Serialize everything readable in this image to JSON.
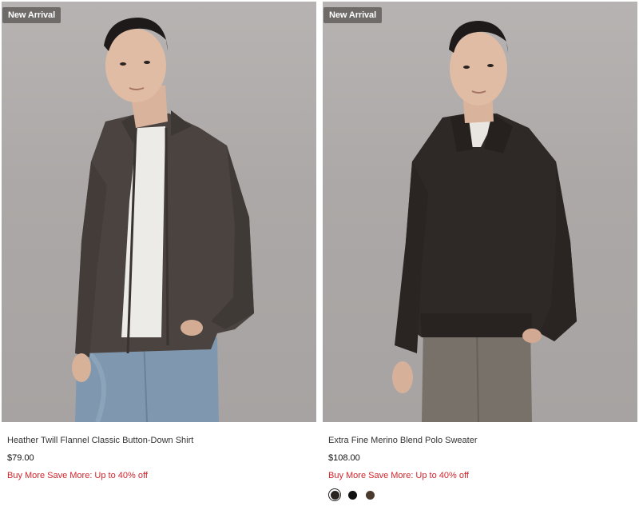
{
  "products": [
    {
      "badge": "New Arrival",
      "name": "Heather Twill Flannel Classic Button-Down Shirt",
      "price": "$79.00",
      "promo": "Buy More Save More: Up to 40% off",
      "image_alt": "model wearing dark brown flannel shirt over white tee with light blue jeans"
    },
    {
      "badge": "New Arrival",
      "name": "Extra Fine Merino Blend Polo Sweater",
      "price": "$108.00",
      "promo": "Buy More Save More: Up to 40% off",
      "image_alt": "model wearing dark brown merino polo sweater with grey trousers",
      "swatches": [
        {
          "color": "#2b2522",
          "selected": true
        },
        {
          "color": "#111111",
          "selected": false
        },
        {
          "color": "#4a3a2e",
          "selected": false
        }
      ]
    }
  ],
  "colors": {
    "promo": "#d0262c",
    "badge_bg": "#6f6b69",
    "photo_bg": "#aca8a7"
  }
}
